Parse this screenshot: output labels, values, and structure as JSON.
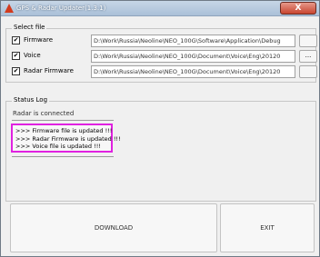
{
  "window": {
    "title": "GPS & Radar Updater(1.3.1)",
    "close_glyph": "X"
  },
  "select_file": {
    "group_title": "Select file",
    "rows": [
      {
        "label": "Firmware",
        "checked_glyph": "✔",
        "path": "D:\\Work\\Russia\\Neoline\\NEO_100G\\Software\\Application\\Debug",
        "browse_label": ""
      },
      {
        "label": "Voice",
        "checked_glyph": "✔",
        "path": "D:\\Work\\Russia\\Neoline\\NEO_100G\\Document\\Voice\\Eng\\20120",
        "browse_label": "..."
      },
      {
        "label": "Radar Firmware",
        "checked_glyph": "✔",
        "path": "D:\\Work\\Russia\\Neoline\\NEO_100G\\Document\\Voice\\Eng\\20120",
        "browse_label": ""
      }
    ]
  },
  "status_log": {
    "group_title": "Status Log",
    "status_text": "Radar is connected",
    "log_lines": [
      ">>> Firmware file is updated !!!",
      ">>> Radar Firmware is updated !!!",
      ">>> Voice file is updated !!!"
    ]
  },
  "buttons": {
    "download_label": "DOWNLOAD",
    "exit_label": "EXIT"
  }
}
